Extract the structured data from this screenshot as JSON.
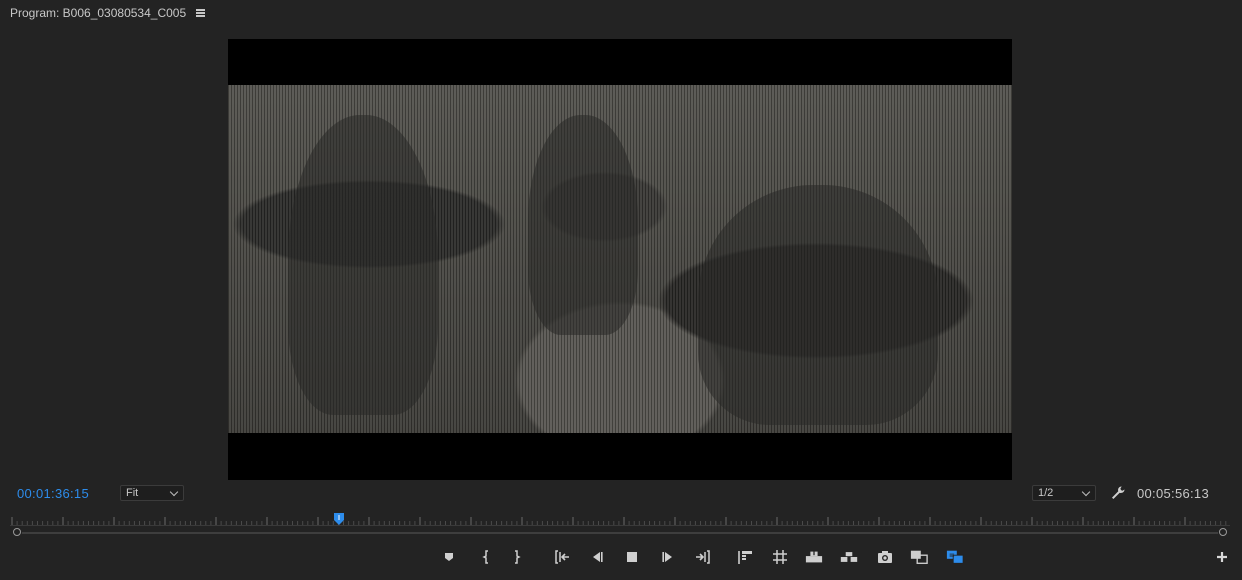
{
  "panel": {
    "title": "Program: B006_03080534_C005"
  },
  "status": {
    "current_timecode": "00:01:36:15",
    "zoom_level": "Fit",
    "resolution": "1/2",
    "duration_timecode": "00:05:56:13"
  },
  "timeline": {
    "playhead_position": 0.27
  },
  "transport_buttons": [
    "add-marker-icon",
    "mark-in-icon",
    "mark-out-icon",
    "go-to-in-icon",
    "step-back-icon",
    "stop-icon",
    "step-forward-icon",
    "go-to-out-icon",
    "insert-icon",
    "trim-icon",
    "lift-icon",
    "extract-icon",
    "export-frame-icon",
    "comparison-view-icon",
    "multicam-icon",
    "plus-icon"
  ],
  "colors": {
    "accent": "#2d8ceb",
    "background": "#232323"
  }
}
